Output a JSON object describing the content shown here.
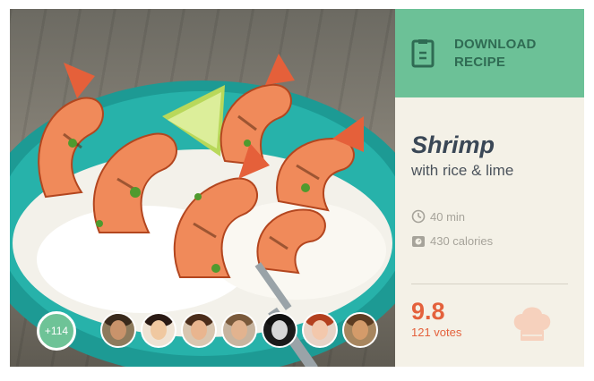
{
  "recipe": {
    "title": "Shrimp",
    "subtitle": "with rice & lime",
    "time": "40 min",
    "calories": "430 calories",
    "rating": "9.8",
    "votes": "121 votes"
  },
  "download": {
    "label_line1": "DOWNLOAD",
    "label_line2": "RECIPE"
  },
  "social": {
    "extra_count": "+114",
    "avatars": [
      {
        "name": "avatar-1"
      },
      {
        "name": "avatar-2"
      },
      {
        "name": "avatar-3"
      },
      {
        "name": "avatar-4"
      },
      {
        "name": "avatar-5"
      },
      {
        "name": "avatar-6"
      },
      {
        "name": "avatar-7"
      }
    ]
  },
  "icons": {
    "download": "document-icon",
    "time": "clock-icon",
    "calories": "scale-icon",
    "rating": "chef-hat-icon"
  },
  "colors": {
    "accent_green": "#6cc197",
    "download_text": "#2f6b53",
    "title": "#3a4756",
    "rating": "#e4613c",
    "muted": "#a6a39a",
    "panel_bg": "#f4f1e7"
  }
}
